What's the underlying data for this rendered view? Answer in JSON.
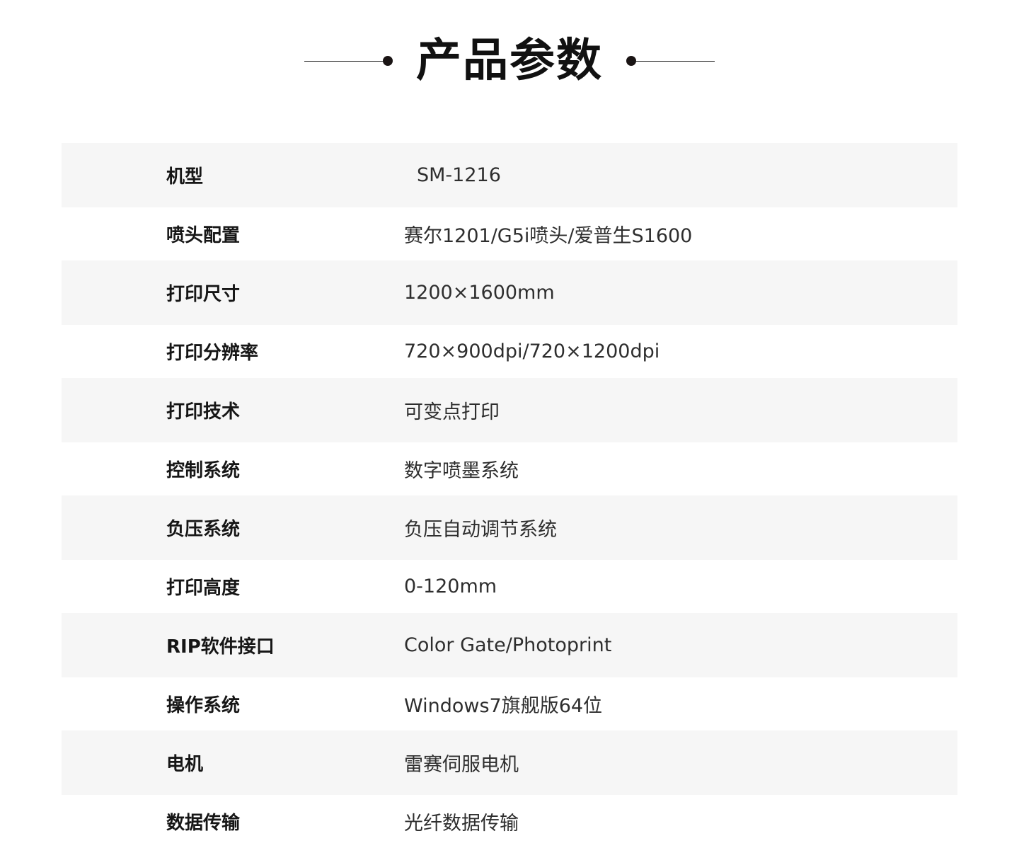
{
  "header": {
    "title": "产品参数"
  },
  "specs": [
    {
      "label": "机型",
      "value": "SM-1216"
    },
    {
      "label": "喷头配置",
      "value": "赛尔1201/G5i喷头/爱普生S1600"
    },
    {
      "label": "打印尺寸",
      "value": "1200×1600mm"
    },
    {
      "label": "打印分辨率",
      "value": "720×900dpi/720×1200dpi"
    },
    {
      "label": "打印技术",
      "value": "可变点打印"
    },
    {
      "label": "控制系统",
      "value": "数字喷墨系统"
    },
    {
      "label": "负压系统",
      "value": "负压自动调节系统"
    },
    {
      "label": "打印高度",
      "value": "0-120mm"
    },
    {
      "label": "RIP软件接口",
      "value": "Color Gate/Photoprint"
    },
    {
      "label": "操作系统",
      "value": "Windows7旗舰版64位"
    },
    {
      "label": "电机",
      "value": "雷赛伺服电机"
    },
    {
      "label": "数据传输",
      "value": "光纤数据传输"
    }
  ],
  "colors": {
    "row_shade": "#f6f6f6",
    "text": "#1a1a1a"
  }
}
